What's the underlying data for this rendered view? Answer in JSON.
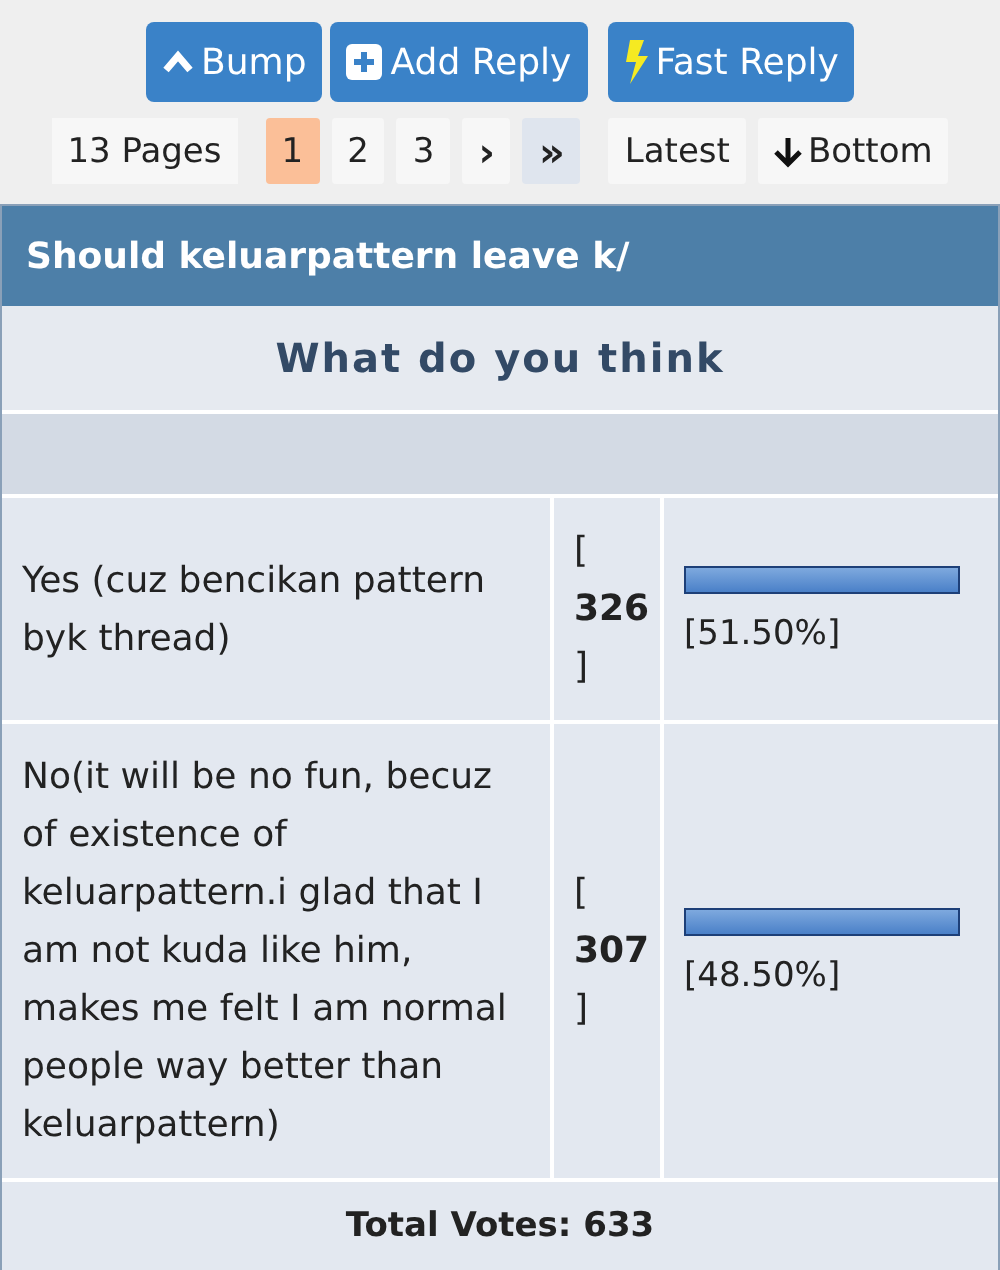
{
  "actions": [
    {
      "kind": "bump",
      "label": "Bump"
    },
    {
      "kind": "add",
      "label": "Add Reply"
    },
    {
      "kind": "fast",
      "label": "Fast Reply"
    }
  ],
  "pagination": {
    "pages_label": "13 Pages",
    "pages": [
      {
        "label": "1",
        "selected": true
      },
      {
        "label": "2",
        "selected": false
      },
      {
        "label": "3",
        "selected": false
      }
    ],
    "next": "›",
    "last": "»",
    "latest": "Latest",
    "bottom": "Bottom"
  },
  "poll": {
    "title": "Should keluarpattern leave k/",
    "question": "What do you think",
    "options": [
      {
        "text": "Yes (cuz bencikan pattern byk thread)",
        "open": "[",
        "votes": "326",
        "close": "]",
        "percent": "[51.50%]"
      },
      {
        "text": "No(it will be no fun, becuz of existence of keluarpattern.i glad that I am not kuda like him, makes me felt I am normal people way better than keluarpattern)",
        "open": "[",
        "votes": "307",
        "close": "]",
        "percent": "[48.50%]"
      }
    ],
    "total": "Total Votes: 633"
  }
}
